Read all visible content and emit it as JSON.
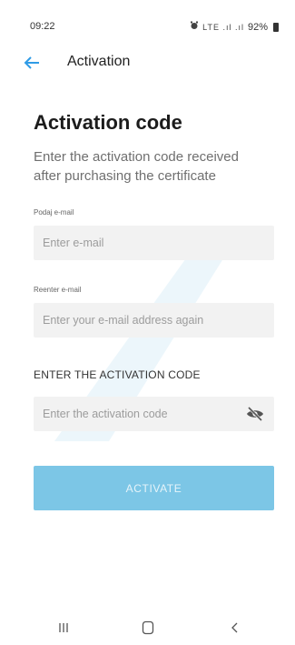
{
  "status_bar": {
    "time": "09:22",
    "icons_text": "LTE .ıl .ıl",
    "battery": "92%",
    "icons": [
      "alarm-icon",
      "signal-icon",
      "battery-icon"
    ]
  },
  "app_bar": {
    "title": "Activation",
    "back_icon": "back-arrow-icon"
  },
  "form": {
    "heading": "Activation code",
    "subheading": "Enter the activation code received after purchasing the certificate",
    "email_label": "Podaj e-mail",
    "email_placeholder": "Enter e-mail",
    "reenter_label": "Reenter e-mail",
    "reenter_placeholder": "Enter your e-mail address again",
    "code_section_title": "ENTER THE ACTIVATION CODE",
    "code_placeholder": "Enter the activation code",
    "visibility_icon": "eye-off-icon",
    "activate_label": "ACTIVATE"
  },
  "nav_bar": {
    "buttons": [
      "recent-apps-icon",
      "home-icon",
      "back-icon"
    ]
  },
  "colors": {
    "accent": "#2f9be6",
    "button_bg": "#7cc6e6",
    "input_bg": "#f2f2f2"
  }
}
